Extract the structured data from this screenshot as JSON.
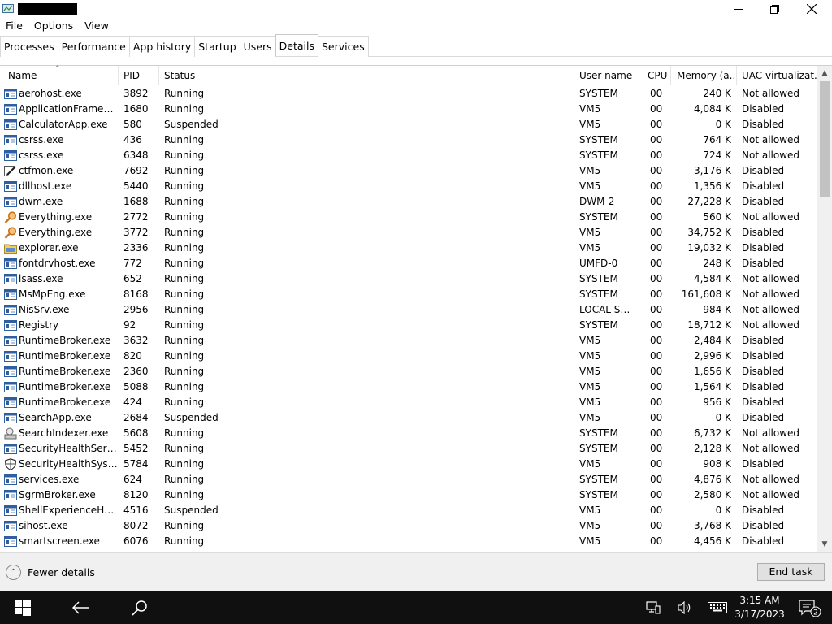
{
  "window": {
    "menu": [
      "File",
      "Options",
      "View"
    ],
    "tabs": [
      "Processes",
      "Performance",
      "App history",
      "Startup",
      "Users",
      "Details",
      "Services"
    ],
    "active_tab": "Details"
  },
  "columns": {
    "name": "Name",
    "pid": "PID",
    "status": "Status",
    "user": "User name",
    "cpu": "CPU",
    "memory": "Memory (a...",
    "uac": "UAC virtualizat..."
  },
  "rows": [
    {
      "icon": "app",
      "name": "aerohost.exe",
      "pid": "3892",
      "status": "Running",
      "user": "SYSTEM",
      "cpu": "00",
      "memory": "240 K",
      "uac": "Not allowed"
    },
    {
      "icon": "app",
      "name": "ApplicationFrameHo...",
      "pid": "1680",
      "status": "Running",
      "user": "VM5",
      "cpu": "00",
      "memory": "4,084 K",
      "uac": "Disabled"
    },
    {
      "icon": "app",
      "name": "CalculatorApp.exe",
      "pid": "580",
      "status": "Suspended",
      "user": "VM5",
      "cpu": "00",
      "memory": "0 K",
      "uac": "Disabled"
    },
    {
      "icon": "app",
      "name": "csrss.exe",
      "pid": "436",
      "status": "Running",
      "user": "SYSTEM",
      "cpu": "00",
      "memory": "764 K",
      "uac": "Not allowed"
    },
    {
      "icon": "app",
      "name": "csrss.exe",
      "pid": "6348",
      "status": "Running",
      "user": "SYSTEM",
      "cpu": "00",
      "memory": "724 K",
      "uac": "Not allowed"
    },
    {
      "icon": "pen",
      "name": "ctfmon.exe",
      "pid": "7692",
      "status": "Running",
      "user": "VM5",
      "cpu": "00",
      "memory": "3,176 K",
      "uac": "Disabled"
    },
    {
      "icon": "app",
      "name": "dllhost.exe",
      "pid": "5440",
      "status": "Running",
      "user": "VM5",
      "cpu": "00",
      "memory": "1,356 K",
      "uac": "Disabled"
    },
    {
      "icon": "app",
      "name": "dwm.exe",
      "pid": "1688",
      "status": "Running",
      "user": "DWM-2",
      "cpu": "00",
      "memory": "27,228 K",
      "uac": "Disabled"
    },
    {
      "icon": "search",
      "name": "Everything.exe",
      "pid": "2772",
      "status": "Running",
      "user": "SYSTEM",
      "cpu": "00",
      "memory": "560 K",
      "uac": "Not allowed"
    },
    {
      "icon": "search",
      "name": "Everything.exe",
      "pid": "3772",
      "status": "Running",
      "user": "VM5",
      "cpu": "00",
      "memory": "34,752 K",
      "uac": "Disabled"
    },
    {
      "icon": "folder",
      "name": "explorer.exe",
      "pid": "2336",
      "status": "Running",
      "user": "VM5",
      "cpu": "00",
      "memory": "19,032 K",
      "uac": "Disabled"
    },
    {
      "icon": "app",
      "name": "fontdrvhost.exe",
      "pid": "772",
      "status": "Running",
      "user": "UMFD-0",
      "cpu": "00",
      "memory": "248 K",
      "uac": "Disabled"
    },
    {
      "icon": "app",
      "name": "lsass.exe",
      "pid": "652",
      "status": "Running",
      "user": "SYSTEM",
      "cpu": "00",
      "memory": "4,584 K",
      "uac": "Not allowed"
    },
    {
      "icon": "app",
      "name": "MsMpEng.exe",
      "pid": "8168",
      "status": "Running",
      "user": "SYSTEM",
      "cpu": "00",
      "memory": "161,608 K",
      "uac": "Not allowed"
    },
    {
      "icon": "app",
      "name": "NisSrv.exe",
      "pid": "2956",
      "status": "Running",
      "user": "LOCAL SE...",
      "cpu": "00",
      "memory": "984 K",
      "uac": "Not allowed"
    },
    {
      "icon": "app",
      "name": "Registry",
      "pid": "92",
      "status": "Running",
      "user": "SYSTEM",
      "cpu": "00",
      "memory": "18,712 K",
      "uac": "Not allowed"
    },
    {
      "icon": "app",
      "name": "RuntimeBroker.exe",
      "pid": "3632",
      "status": "Running",
      "user": "VM5",
      "cpu": "00",
      "memory": "2,484 K",
      "uac": "Disabled"
    },
    {
      "icon": "app",
      "name": "RuntimeBroker.exe",
      "pid": "820",
      "status": "Running",
      "user": "VM5",
      "cpu": "00",
      "memory": "2,996 K",
      "uac": "Disabled"
    },
    {
      "icon": "app",
      "name": "RuntimeBroker.exe",
      "pid": "2360",
      "status": "Running",
      "user": "VM5",
      "cpu": "00",
      "memory": "1,656 K",
      "uac": "Disabled"
    },
    {
      "icon": "app",
      "name": "RuntimeBroker.exe",
      "pid": "5088",
      "status": "Running",
      "user": "VM5",
      "cpu": "00",
      "memory": "1,564 K",
      "uac": "Disabled"
    },
    {
      "icon": "app",
      "name": "RuntimeBroker.exe",
      "pid": "424",
      "status": "Running",
      "user": "VM5",
      "cpu": "00",
      "memory": "956 K",
      "uac": "Disabled"
    },
    {
      "icon": "app",
      "name": "SearchApp.exe",
      "pid": "2684",
      "status": "Suspended",
      "user": "VM5",
      "cpu": "00",
      "memory": "0 K",
      "uac": "Disabled"
    },
    {
      "icon": "indexer",
      "name": "SearchIndexer.exe",
      "pid": "5608",
      "status": "Running",
      "user": "SYSTEM",
      "cpu": "00",
      "memory": "6,732 K",
      "uac": "Not allowed"
    },
    {
      "icon": "app",
      "name": "SecurityHealthServic...",
      "pid": "5452",
      "status": "Running",
      "user": "SYSTEM",
      "cpu": "00",
      "memory": "2,128 K",
      "uac": "Not allowed"
    },
    {
      "icon": "shield",
      "name": "SecurityHealthSystra...",
      "pid": "5784",
      "status": "Running",
      "user": "VM5",
      "cpu": "00",
      "memory": "908 K",
      "uac": "Disabled"
    },
    {
      "icon": "app",
      "name": "services.exe",
      "pid": "624",
      "status": "Running",
      "user": "SYSTEM",
      "cpu": "00",
      "memory": "4,876 K",
      "uac": "Not allowed"
    },
    {
      "icon": "app",
      "name": "SgrmBroker.exe",
      "pid": "8120",
      "status": "Running",
      "user": "SYSTEM",
      "cpu": "00",
      "memory": "2,580 K",
      "uac": "Not allowed"
    },
    {
      "icon": "app",
      "name": "ShellExperienceHost....",
      "pid": "4516",
      "status": "Suspended",
      "user": "VM5",
      "cpu": "00",
      "memory": "0 K",
      "uac": "Disabled"
    },
    {
      "icon": "app",
      "name": "sihost.exe",
      "pid": "8072",
      "status": "Running",
      "user": "VM5",
      "cpu": "00",
      "memory": "3,768 K",
      "uac": "Disabled"
    },
    {
      "icon": "app",
      "name": "smartscreen.exe",
      "pid": "6076",
      "status": "Running",
      "user": "VM5",
      "cpu": "00",
      "memory": "4,456 K",
      "uac": "Disabled"
    }
  ],
  "footer": {
    "fewer_details": "Fewer details",
    "end_task": "End task"
  },
  "taskbar": {
    "time": "3:15 AM",
    "date": "3/17/2023",
    "notification_count": "2"
  }
}
